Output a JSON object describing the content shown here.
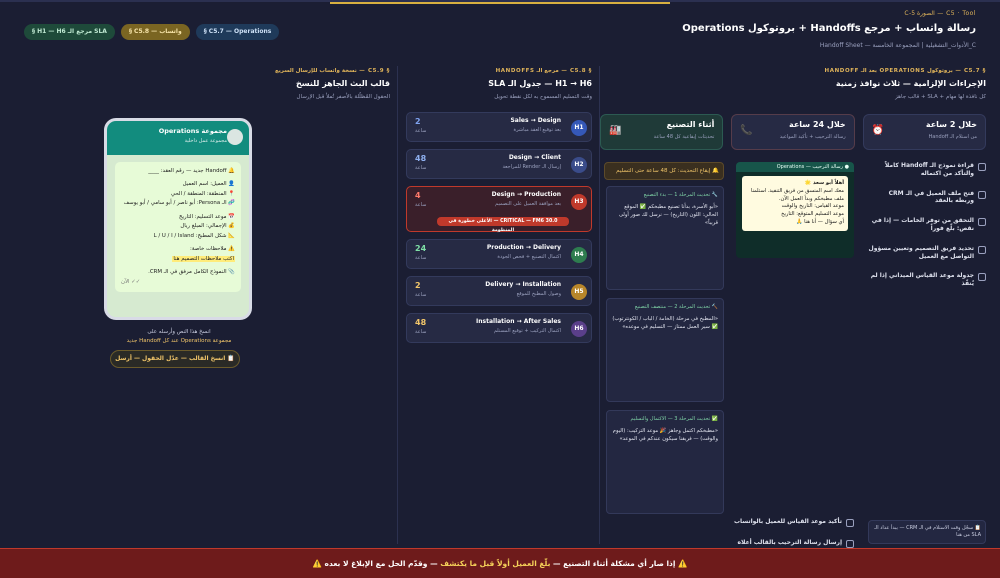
{
  "header": {
    "eyebrow": "C5 · Tool — الصورة 5-C",
    "title": "رسالة واتساب + مرجع Handoffs + بروتوكول Operations",
    "subtitle": "C_الأدوات_التشغيلية | المجموعة الخامسة — Handoff Sheet",
    "chips": [
      "§ C5.7 — Operations",
      "§ C5.8 — واتساب",
      "§ H1 — H6 مرجع الـ SLA"
    ]
  },
  "col1": {
    "kicker": "§ C5.7 — بروتوكول OPERATIONS بعد الـ HANDOFF",
    "title": "الإجراءات الإلزامية — ثلاث نوافذ زمنية",
    "sub": "كل نافذة لها مهام + SLA + قالب جاهز",
    "windows": [
      {
        "title": "خلال 2 ساعة",
        "sub": "من استلام الـ Handoff",
        "icon": "⏰"
      },
      {
        "title": "خلال 24 ساعة",
        "sub": "رسالة الترحيب + تأكيد المواعيد",
        "icon": "📞"
      },
      {
        "title": "أثناء التصنيع",
        "sub": "تحديثات إيقاعية كل 48 ساعة",
        "icon": "🏭"
      }
    ],
    "checks": [
      "قراءة نموذج الـ Handoff كاملاً والتأكد من اكتماله",
      "فتح ملف العميل في الـ CRM وربطه بالعقد",
      "التحقق من توفر الخامات — إذا في نقص: بلّغ فوراً",
      "تحديد فريق التصميم وتعيين مسؤول التواصل مع العميل",
      "جدولة موعد القياس الميداني إذا لم يُنفّذ"
    ],
    "mini_head": "● رسالة الترحيب — Operations",
    "mini_greet": "أهلاً أبو سعد 🌟",
    "mini_body": "معك اسم المنسق من فريق التنفيذ. استلمنا ملف مطبخكم وبدأ العمل الآن.",
    "mini_measure": "موعد القياس: التاريخ والوقت",
    "mini_delivery": "موعد التسليم المتوقع: التاريخ",
    "mini_end": "أي سؤال — أنا هنا 🙏",
    "tag48": "🔔 إيقاع التحديث: كل 48 ساعة حتى التسليم",
    "updates": [
      {
        "head": "🔧 تحديث المرحلة 1 — بدء التصنيع",
        "body": "«أبو الأسرة، بدأنا تصنيع مطبخكم ✅ الموقع الحالي: اللون (التاريخ) — نرسل لك صور أولى قريباً»"
      },
      {
        "head": "🔨 تحديث المرحلة 2 — منتصف التصنيع",
        "body": "«المطبخ في مرحلة (الخامة / الباب / الكونترتوب) ✅ سير العمل ممتاز — التسليم في موعده»"
      },
      {
        "head": "✅ تحديث المرحلة 3 — الاكتمال والتسليم",
        "body": "«مطبخكم اكتمل وجاهز 🎉 موعد التركيب: (اليوم والوقت) — فريقنا سيكون عندكم في الموعد»"
      }
    ],
    "foot_note": "📋 سجّل وقت الاستلام في الـ CRM — يبدأ عداد الـ SLA من هنا",
    "foot_checks": [
      "تأكيد موعد القياس للعميل بالواتساب",
      "إرسال رسالة الترحيب بالقالب أعلاه"
    ]
  },
  "col2": {
    "kicker": "§ C5.8 — مرجع الـ HANDOFFS",
    "title": "H1 → H6 — جدول الـ SLA",
    "sub": "وقت التسليم المسموح به لكل نقطة تحويل",
    "steps": [
      {
        "badge": "H1",
        "label": "Sales → Design",
        "sub": "بعد توقيع العقد مباشرة",
        "hours": "2",
        "unit": "ساعة",
        "color": "#3558b8",
        "hcolor": "#7fa3f0"
      },
      {
        "badge": "H2",
        "label": "Design → Client",
        "sub": "إرسال الـ Render للمراجعة",
        "hours": "48",
        "unit": "ساعة",
        "color": "#3a4c8a",
        "hcolor": "#8fb0f0"
      },
      {
        "badge": "H3",
        "label": "Design → Production",
        "sub": "بعد موافقة العميل على التصميم",
        "hours": "4",
        "unit": "ساعة",
        "color": "#c0392b",
        "hcolor": "#ff7a6a",
        "critical": "CRITICAL — FM6 30.0 — الأعلى خطورة في المنظومة"
      },
      {
        "badge": "H4",
        "label": "Production → Delivery",
        "sub": "اكتمال التصنيع + فحص الجودة",
        "hours": "24",
        "unit": "ساعة",
        "color": "#2e7d4f",
        "hcolor": "#7ee0a6"
      },
      {
        "badge": "H5",
        "label": "Delivery → Installation",
        "sub": "وصول المطبخ للموقع",
        "hours": "2",
        "unit": "ساعة",
        "color": "#b8862a",
        "hcolor": "#f2c66a"
      },
      {
        "badge": "H6",
        "label": "Installation → After Sales",
        "sub": "اكتمال التركيب + توقيع المستلم",
        "hours": "48",
        "unit": "ساعة",
        "color": "#5a3f8a",
        "hcolor": "#f2c66a"
      }
    ]
  },
  "col3": {
    "kicker": "§ C5.9 — نسخة واتساب للإرسال السريع",
    "title": "قالب البث الجاهز للنسخ",
    "sub": "الحقول المُظلّلة بالأصفر تُملأ قبل الإرسال",
    "chat_name": "مجموعة Operations",
    "chat_sub": "مجموعة عمل داخلية",
    "msg": {
      "l1": "🔔 Handoff جديد — رقم العقد: ____",
      "l2": "👤 العميل: اسم العميل",
      "l3": "📍 المنطقة: المنطقة / الحي",
      "l4": "🧬 الـ Persona: أبو ناصر / أبو سامي / أبو يوسف",
      "l5": "📅 موعد التسليم: التاريخ",
      "l6": "💰 الإجمالي: المبلغ ريال",
      "l7": "📐 شكل المطبخ: L / U / I / Island",
      "l8": "⚠️ ملاحظات خاصة:",
      "l9": "اكتب ملاحظات التصميم هنا",
      "l10": "📎 النموذج الكامل مرفق في الـ CRM.",
      "l11": "✓✓ الآن"
    },
    "caption1": "انسخ هذا النص وأرسله على",
    "caption2": "مجموعة Operations عند كل Handoff جديد",
    "copy_btn": "📋 انسخ القالب — عدّل الحقول — أرسل"
  },
  "alert": {
    "pre": "⚠️ إذا صار أي مشكلة أثناء التصنيع — ",
    "mid": "بلّغ العميل أولاً قبل ما يكتشف",
    "post": " — وقدّم الحل مع الإبلاغ لا بعده ⚠️"
  }
}
